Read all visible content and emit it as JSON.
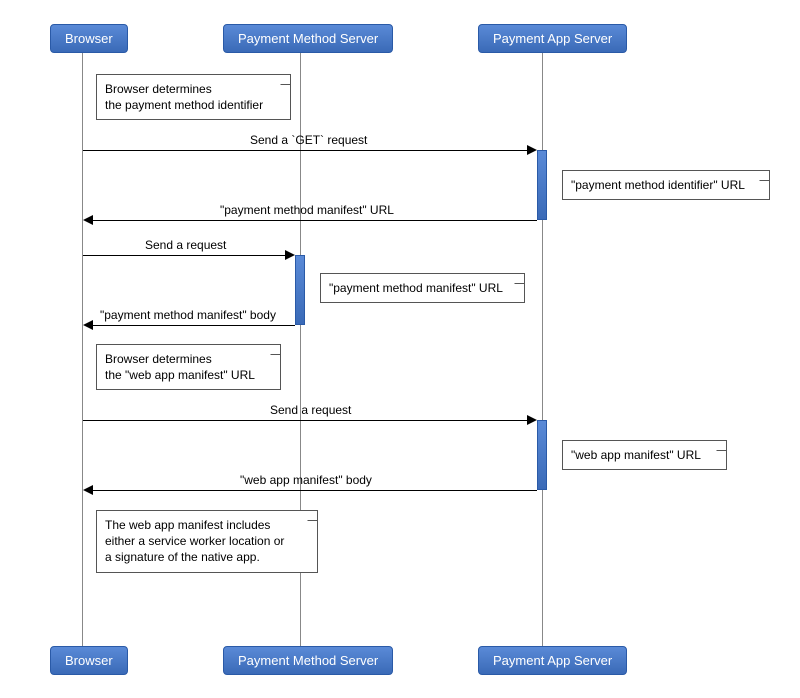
{
  "participants": {
    "browser": "Browser",
    "pms": "Payment Method Server",
    "pas": "Payment App Server"
  },
  "notes": {
    "n1_line1": "Browser determines",
    "n1_line2": "the payment method identifier",
    "n2": "\"payment method identifier\" URL",
    "n3": "\"payment method manifest\" URL",
    "n4_line1": "Browser determines",
    "n4_line2": "the \"web app manifest\" URL",
    "n5": "\"web app manifest\" URL",
    "n6_line1": "The web app manifest includes",
    "n6_line2": "either a service worker location or",
    "n6_line3": "a signature of the native app."
  },
  "messages": {
    "m1": "Send a `GET` request",
    "m2": "\"payment method manifest\" URL",
    "m3": "Send a request",
    "m4": "\"payment method manifest\" body",
    "m5": "Send a request",
    "m6": "\"web app manifest\" body"
  }
}
